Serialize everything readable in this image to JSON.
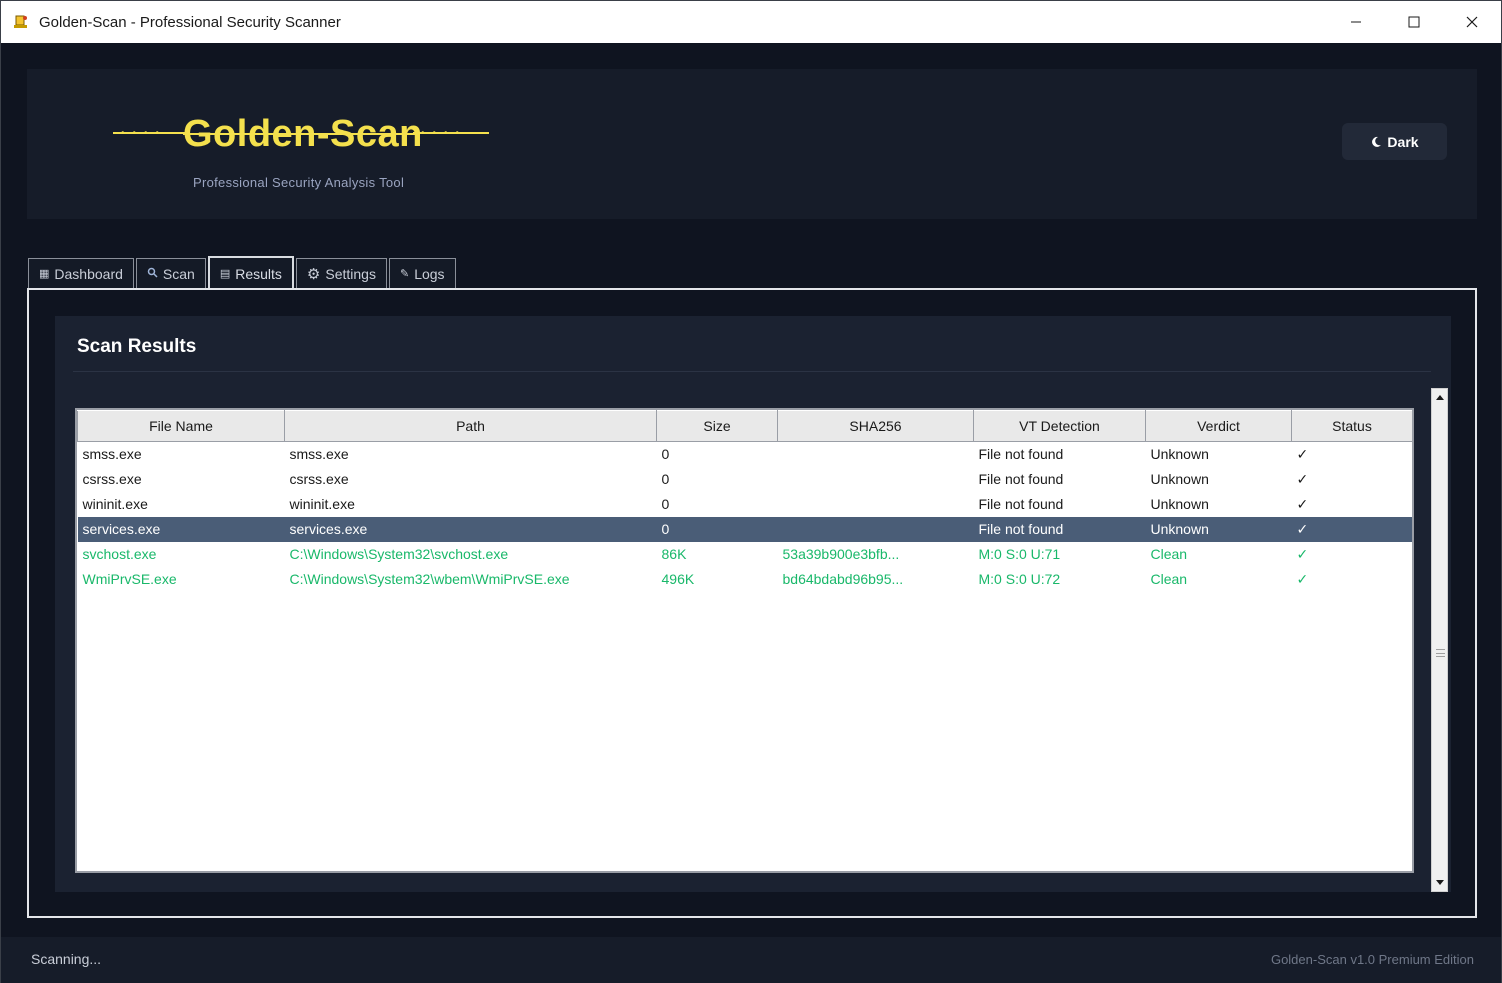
{
  "window": {
    "title": "Golden-Scan - Professional Security Scanner",
    "controls": {
      "minimize": "—",
      "maximize": "☐",
      "close": "✕"
    }
  },
  "header": {
    "logo_text": "Golden-Scan",
    "subtitle": "Professional Security Analysis Tool",
    "theme_button": {
      "icon": "moon-icon",
      "label": "Dark"
    }
  },
  "tabs": [
    {
      "icon": "dashboard-icon",
      "glyph": "▦",
      "label": "Dashboard",
      "active": false
    },
    {
      "icon": "search-icon",
      "glyph": "🔍",
      "label": "Scan",
      "active": false
    },
    {
      "icon": "clipboard-icon",
      "glyph": "▤",
      "label": "Results",
      "active": true
    },
    {
      "icon": "gear-icon",
      "glyph": "⚙",
      "label": "Settings",
      "active": false
    },
    {
      "icon": "log-icon",
      "glyph": "✎",
      "label": "Logs",
      "active": false
    }
  ],
  "results": {
    "title": "Scan Results",
    "columns": [
      "File Name",
      "Path",
      "Size",
      "SHA256",
      "VT Detection",
      "Verdict",
      "Status"
    ],
    "rows": [
      [
        "smss.exe",
        "smss.exe",
        "0",
        "",
        "File not found",
        "Unknown",
        "✓"
      ],
      [
        "csrss.exe",
        "csrss.exe",
        "0",
        "",
        "File not found",
        "Unknown",
        "✓"
      ],
      [
        "wininit.exe",
        "wininit.exe",
        "0",
        "",
        "File not found",
        "Unknown",
        "✓"
      ],
      [
        "services.exe",
        "services.exe",
        "0",
        "",
        "File not found",
        "Unknown",
        "✓"
      ],
      [
        "svchost.exe",
        "C:\\Windows\\System32\\svchost.exe",
        "86K",
        "53a39b900e3bfb...",
        "M:0 S:0 U:71",
        "Clean",
        "✓"
      ],
      [
        "WmiPrvSE.exe",
        "C:\\Windows\\System32\\wbem\\WmiPrvSE.exe",
        "496K",
        "bd64bdabd96b95...",
        "M:0 S:0 U:72",
        "Clean",
        "✓"
      ]
    ],
    "selected_row": 3,
    "clean_rows": [
      4,
      5
    ]
  },
  "statusbar": {
    "left": "Scanning...",
    "right": "Golden-Scan v1.0 Premium Edition"
  },
  "colors": {
    "background": "#0f1420",
    "header_bg": "#161c29",
    "logo_yellow": "#f4e04d",
    "clean_green": "#19b86a",
    "selected_row": "#4a5d77"
  }
}
